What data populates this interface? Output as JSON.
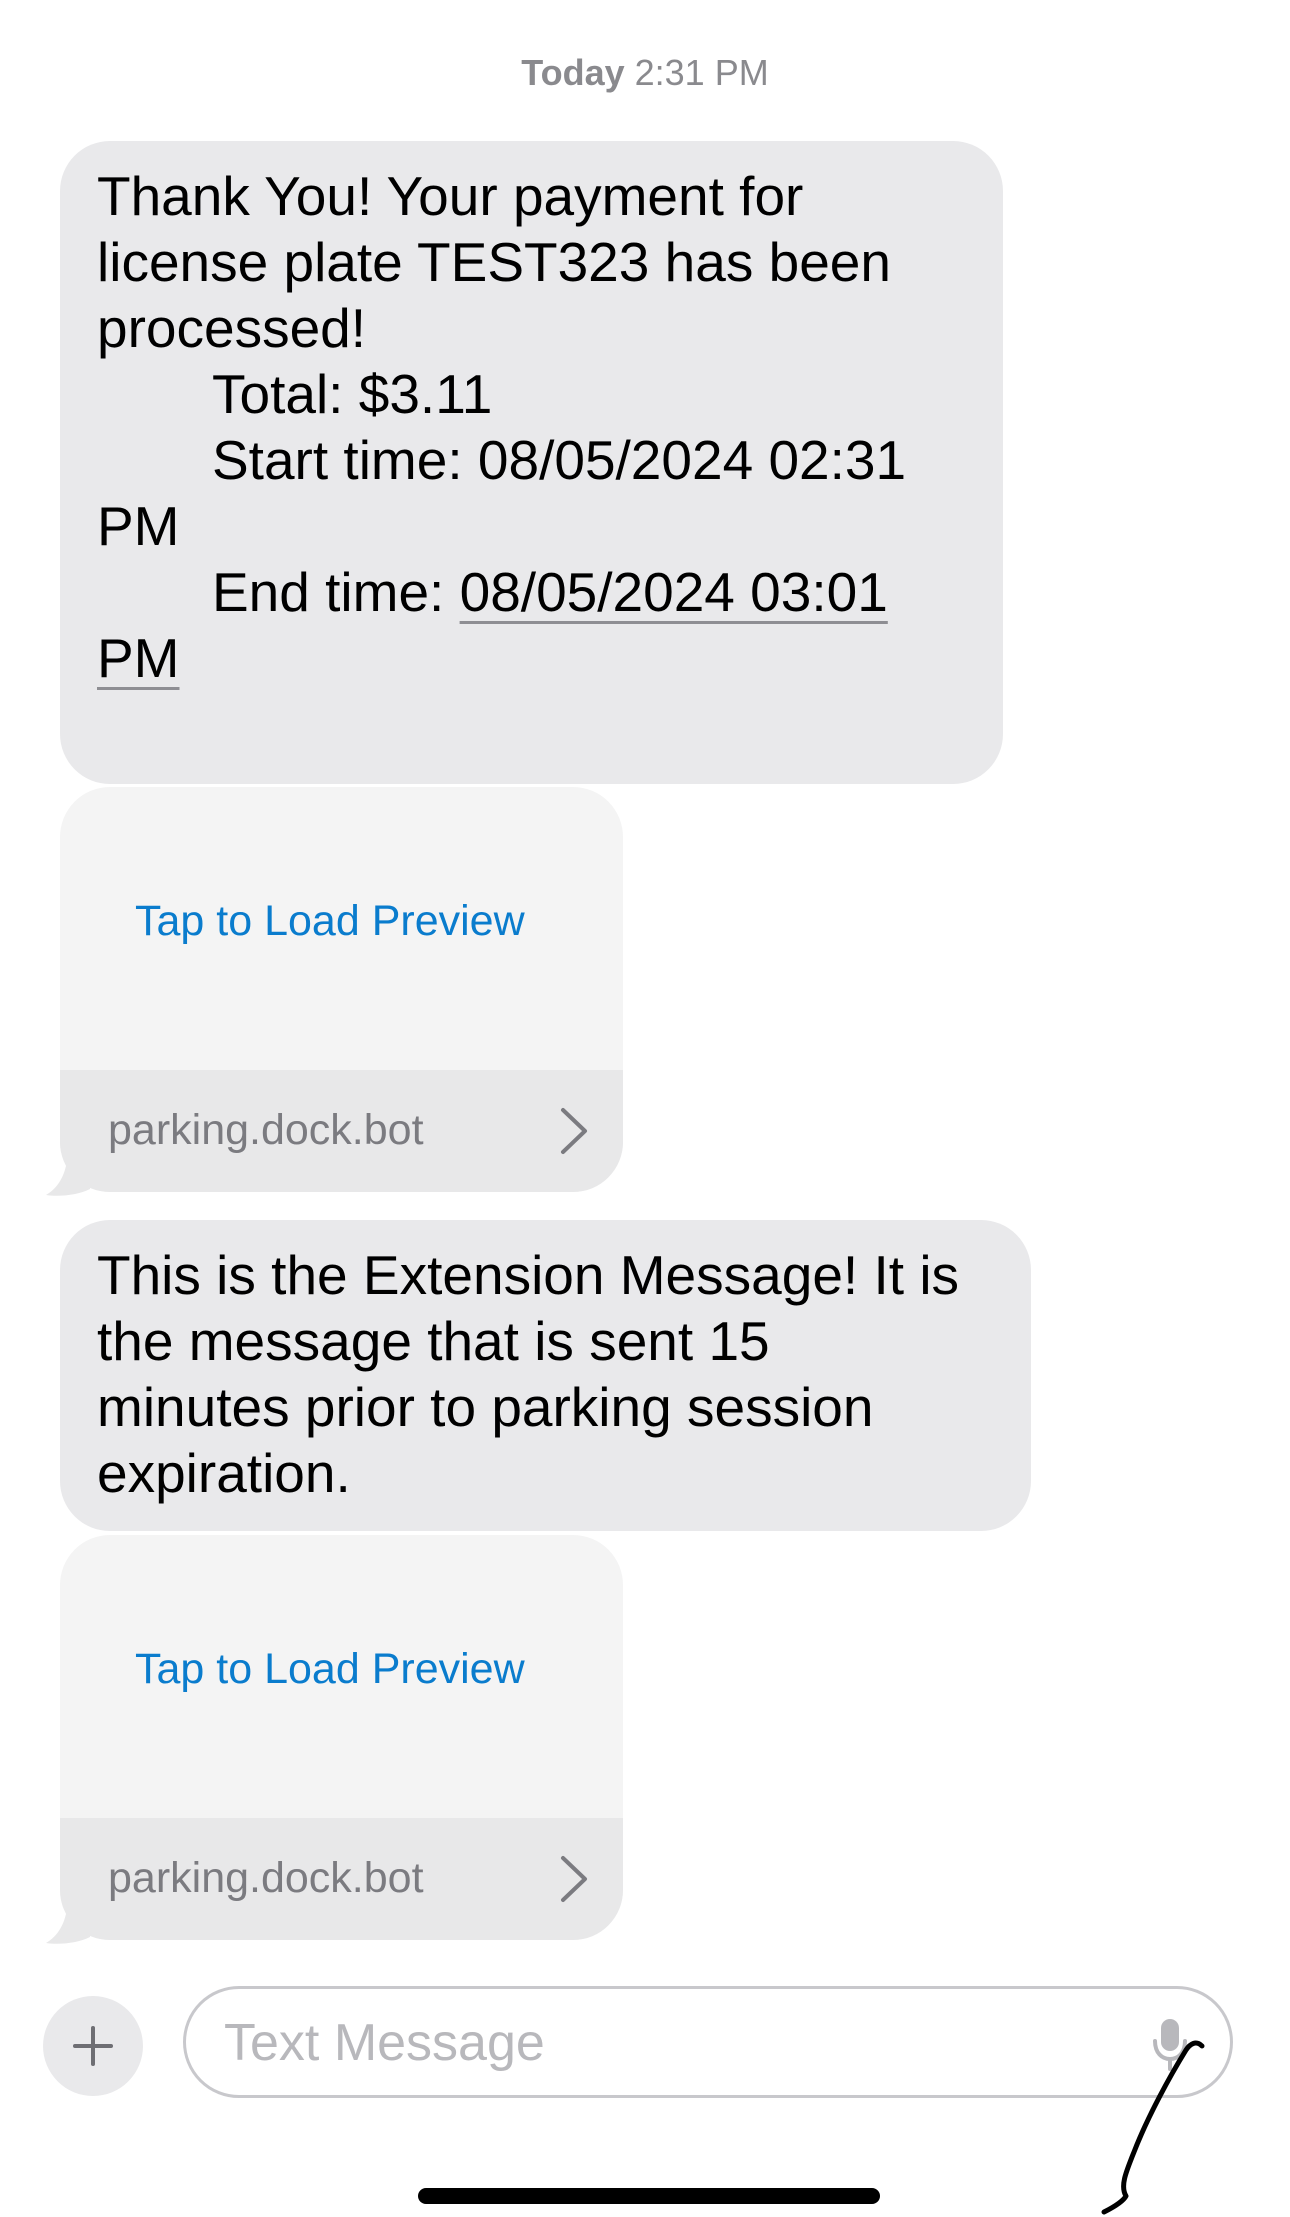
{
  "header": {
    "day": "Today",
    "time": "2:31 PM"
  },
  "messages": [
    {
      "lines": [
        "Thank You! Your payment for",
        "license plate TEST323 has been",
        "processed!",
        "Total: $3.11",
        "Start time: 08/05/2024 02:31",
        "PM",
        "End time: ",
        "08/05/2024 03:01",
        "PM"
      ]
    },
    {
      "lines": [
        "This is the Extension Message! It is",
        "the message that is sent 15",
        "minutes prior to parking session",
        "expiration."
      ]
    }
  ],
  "link_previews": [
    {
      "action_label": "Tap to Load Preview",
      "domain": "parking.dock.bot"
    },
    {
      "action_label": "Tap to Load Preview",
      "domain": "parking.dock.bot"
    }
  ],
  "composer": {
    "placeholder": "Text Message",
    "add_icon": "plus-icon",
    "mic_icon": "microphone-icon"
  },
  "colors": {
    "incoming_bubble": "#e9e9eb",
    "link_blue": "#0a7ccd",
    "timestamp_gray": "#8a8a8e"
  }
}
